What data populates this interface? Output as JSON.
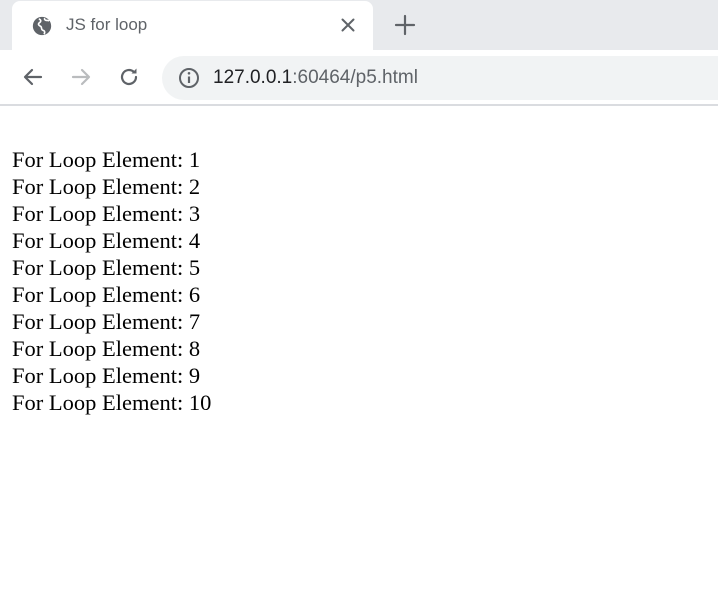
{
  "tab": {
    "title": "JS for loop",
    "favicon": "globe-icon",
    "close_icon": "close-icon"
  },
  "toolbar": {
    "back_icon": "back-arrow-icon",
    "forward_icon": "forward-arrow-icon",
    "reload_icon": "reload-icon",
    "new_tab_icon": "plus-icon"
  },
  "address": {
    "info_icon": "info-icon",
    "host": "127.0.0.1",
    "rest": ":60464/p5.html"
  },
  "content": {
    "lines": [
      "For Loop Element: 1",
      "For Loop Element: 2",
      "For Loop Element: 3",
      "For Loop Element: 4",
      "For Loop Element: 5",
      "For Loop Element: 6",
      "For Loop Element: 7",
      "For Loop Element: 8",
      "For Loop Element: 9",
      "For Loop Element: 10"
    ]
  },
  "colors": {
    "tabstrip": "#e8eaed",
    "omnibox": "#f1f3f4",
    "icon": "#5f6368",
    "disabled_icon": "#babcbe"
  }
}
